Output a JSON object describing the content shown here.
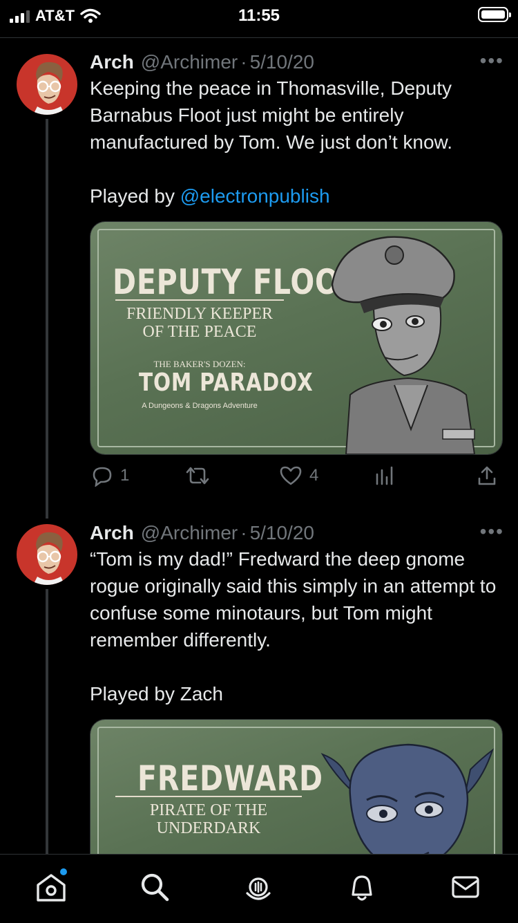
{
  "status_bar": {
    "carrier": "AT&T",
    "time": "11:55"
  },
  "tweets": [
    {
      "name": "Arch",
      "handle": "@Archimer",
      "separator": "·",
      "date": "5/10/20",
      "more": "•••",
      "text": "Keeping the peace in Thomasville, Deputy Barnabus Floot just might be entirely manufactured by Tom. We just don’t know.",
      "played_by_prefix": "Played by ",
      "played_by_name": "@electronpublish",
      "card": {
        "title": "DEPUTY FLOOT",
        "subtitle_line1": "FRIENDLY KEEPER",
        "subtitle_line2": "OF THE PEACE",
        "series": "THE BAKER'S DOZEN:",
        "series_title": "TOM PARADOX",
        "tagline": "A Dungeons & Dragons Adventure"
      },
      "stats": {
        "replies": "1",
        "retweets": "",
        "likes": "4"
      }
    },
    {
      "name": "Arch",
      "handle": "@Archimer",
      "separator": "·",
      "date": "5/10/20",
      "more": "•••",
      "text": "“Tom is my dad!” Fredward the deep gnome rogue originally said this simply in an attempt to confuse some minotaurs, but Tom might remember differently.",
      "played_by_prefix": "Played by ",
      "played_by_name": "Zach",
      "card": {
        "title": "FREDWARD",
        "subtitle_line1": "PIRATE OF THE",
        "subtitle_line2": "UNDERDARK"
      }
    }
  ],
  "nav": {
    "items": [
      "home-icon",
      "search-icon",
      "spaces-icon",
      "notifications-icon",
      "messages-icon"
    ],
    "accent": "#1d9bf0"
  }
}
